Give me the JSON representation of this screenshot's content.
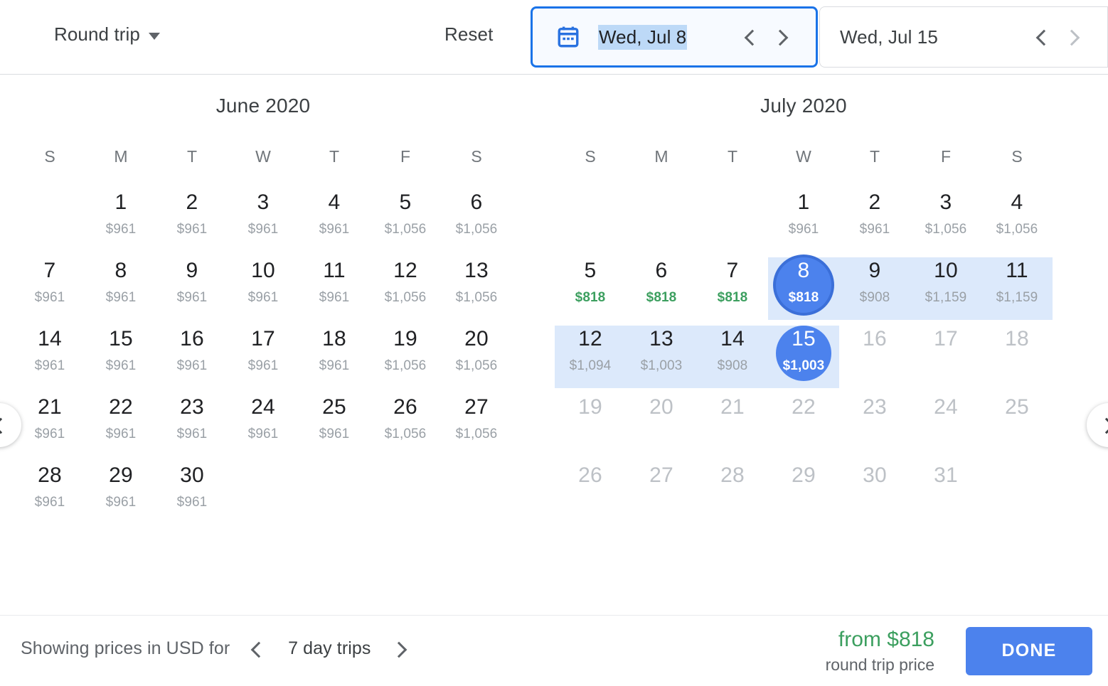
{
  "header": {
    "trip_type": "Round trip",
    "trip_type_icon": "chevron-down-icon",
    "reset_label": "Reset",
    "depart": {
      "icon": "calendar-icon",
      "value": "Wed, Jul 8",
      "prev_icon": "chevron-left-icon",
      "next_icon": "chevron-right-icon"
    },
    "return": {
      "value": "Wed, Jul 15",
      "prev_icon": "chevron-left-icon",
      "next_icon": "chevron-right-icon"
    }
  },
  "nav": {
    "prev_month_icon": "chevron-left-icon",
    "next_month_icon": "chevron-right-icon"
  },
  "calendar": {
    "weekdays": [
      "S",
      "M",
      "T",
      "W",
      "T",
      "F",
      "S"
    ],
    "months": [
      {
        "title": "June 2020",
        "lead_blanks": 1,
        "days": [
          {
            "day": "1",
            "price": "$961"
          },
          {
            "day": "2",
            "price": "$961"
          },
          {
            "day": "3",
            "price": "$961"
          },
          {
            "day": "4",
            "price": "$961"
          },
          {
            "day": "5",
            "price": "$1,056"
          },
          {
            "day": "6",
            "price": "$1,056"
          },
          {
            "day": "7",
            "price": "$961"
          },
          {
            "day": "8",
            "price": "$961"
          },
          {
            "day": "9",
            "price": "$961"
          },
          {
            "day": "10",
            "price": "$961"
          },
          {
            "day": "11",
            "price": "$961"
          },
          {
            "day": "12",
            "price": "$1,056"
          },
          {
            "day": "13",
            "price": "$1,056"
          },
          {
            "day": "14",
            "price": "$961"
          },
          {
            "day": "15",
            "price": "$961"
          },
          {
            "day": "16",
            "price": "$961"
          },
          {
            "day": "17",
            "price": "$961"
          },
          {
            "day": "18",
            "price": "$961"
          },
          {
            "day": "19",
            "price": "$1,056"
          },
          {
            "day": "20",
            "price": "$1,056"
          },
          {
            "day": "21",
            "price": "$961"
          },
          {
            "day": "22",
            "price": "$961"
          },
          {
            "day": "23",
            "price": "$961"
          },
          {
            "day": "24",
            "price": "$961"
          },
          {
            "day": "25",
            "price": "$961"
          },
          {
            "day": "26",
            "price": "$1,056"
          },
          {
            "day": "27",
            "price": "$1,056"
          },
          {
            "day": "28",
            "price": "$961"
          },
          {
            "day": "29",
            "price": "$961"
          },
          {
            "day": "30",
            "price": "$961"
          }
        ]
      },
      {
        "title": "July 2020",
        "lead_blanks": 3,
        "days": [
          {
            "day": "1",
            "price": "$961"
          },
          {
            "day": "2",
            "price": "$961"
          },
          {
            "day": "3",
            "price": "$1,056"
          },
          {
            "day": "4",
            "price": "$1,056"
          },
          {
            "day": "5",
            "price": "$818",
            "cheapest": true
          },
          {
            "day": "6",
            "price": "$818",
            "cheapest": true
          },
          {
            "day": "7",
            "price": "$818",
            "cheapest": true
          },
          {
            "day": "8",
            "price": "$818",
            "selected": true,
            "focus_ring": true,
            "in_range": true
          },
          {
            "day": "9",
            "price": "$908",
            "in_range": true
          },
          {
            "day": "10",
            "price": "$1,159",
            "in_range": true
          },
          {
            "day": "11",
            "price": "$1,159",
            "in_range": true
          },
          {
            "day": "12",
            "price": "$1,094",
            "in_range": true
          },
          {
            "day": "13",
            "price": "$1,003",
            "in_range": true
          },
          {
            "day": "14",
            "price": "$908",
            "in_range": true
          },
          {
            "day": "15",
            "price": "$1,003",
            "selected": true,
            "in_range": true
          },
          {
            "day": "16",
            "price": "",
            "disabled": true
          },
          {
            "day": "17",
            "price": "",
            "disabled": true
          },
          {
            "day": "18",
            "price": "",
            "disabled": true
          },
          {
            "day": "19",
            "price": "",
            "disabled": true
          },
          {
            "day": "20",
            "price": "",
            "disabled": true
          },
          {
            "day": "21",
            "price": "",
            "disabled": true
          },
          {
            "day": "22",
            "price": "",
            "disabled": true
          },
          {
            "day": "23",
            "price": "",
            "disabled": true
          },
          {
            "day": "24",
            "price": "",
            "disabled": true
          },
          {
            "day": "25",
            "price": "",
            "disabled": true
          },
          {
            "day": "26",
            "price": "",
            "disabled": true
          },
          {
            "day": "27",
            "price": "",
            "disabled": true
          },
          {
            "day": "28",
            "price": "",
            "disabled": true
          },
          {
            "day": "29",
            "price": "",
            "disabled": true
          },
          {
            "day": "30",
            "price": "",
            "disabled": true
          },
          {
            "day": "31",
            "price": "",
            "disabled": true
          }
        ]
      }
    ]
  },
  "footer": {
    "showing_label": "Showing prices in USD for",
    "trip_length": "7 day trips",
    "prev_icon": "chevron-left-icon",
    "next_icon": "chevron-right-icon",
    "price_main": "from $818",
    "price_sub": "round trip price",
    "done_label": "DONE"
  },
  "colors": {
    "accent_blue": "#4c82ed",
    "focus_blue": "#1a73e8",
    "range_band": "#dce9fb",
    "cheap_green": "#3c9f5f",
    "muted_gray": "#9aa0a6"
  }
}
